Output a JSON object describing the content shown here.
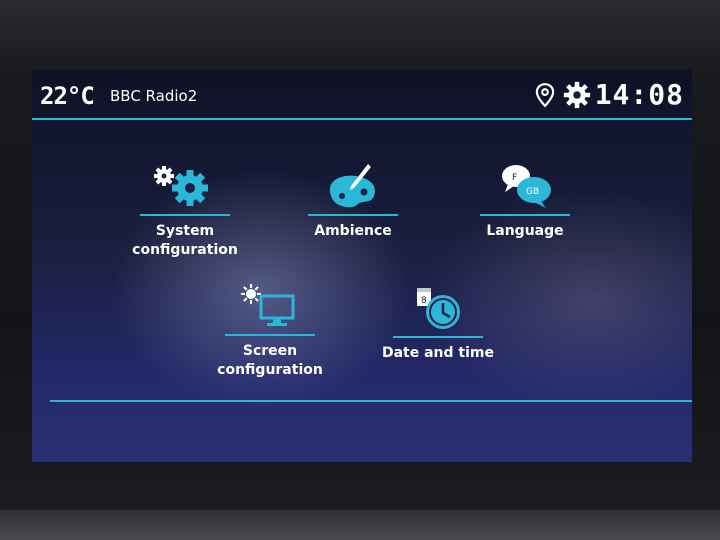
{
  "status_bar": {
    "temperature": "22°C",
    "station": "BBC Radio2",
    "location_icon": "location-pin-icon",
    "settings_icon": "gear-icon",
    "time": "14:08"
  },
  "menu": {
    "items": [
      {
        "label": "System\nconfiguration",
        "icon": "gears-icon"
      },
      {
        "label": "Ambience",
        "icon": "palette-icon"
      },
      {
        "label": "Language",
        "icon": "speech-bubbles-icon",
        "icon_text_1": "F",
        "icon_text_2": "GB"
      },
      {
        "label": "Screen\nconfiguration",
        "icon": "monitor-brightness-icon"
      },
      {
        "label": "Date and time",
        "icon": "calendar-clock-icon",
        "icon_text_1": "8"
      }
    ]
  },
  "colors": {
    "accent": "#2bb7d8",
    "text": "#ffffff"
  }
}
